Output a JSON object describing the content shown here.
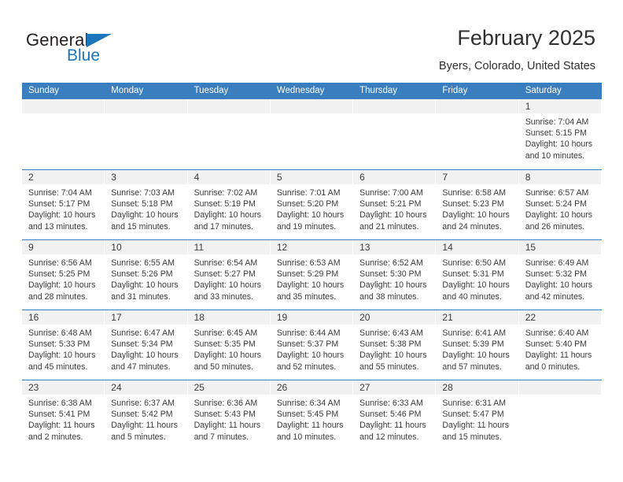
{
  "brand": {
    "name_part1": "General",
    "name_part2": "Blue",
    "triangle_icon": "triangle-icon",
    "accent_color": "#1c76bc"
  },
  "header": {
    "title": "February 2025",
    "location": "Byers, Colorado, United States"
  },
  "theme": {
    "header_blue": "#3a7ebf",
    "daynum_band": "#f1f1f1",
    "text": "#3b3b3b"
  },
  "calendar": {
    "weekdays": [
      "Sunday",
      "Monday",
      "Tuesday",
      "Wednesday",
      "Thursday",
      "Friday",
      "Saturday"
    ],
    "weeks": [
      [
        {
          "day": "",
          "lines": []
        },
        {
          "day": "",
          "lines": []
        },
        {
          "day": "",
          "lines": []
        },
        {
          "day": "",
          "lines": []
        },
        {
          "day": "",
          "lines": []
        },
        {
          "day": "",
          "lines": []
        },
        {
          "day": "1",
          "lines": [
            "Sunrise: 7:04 AM",
            "Sunset: 5:15 PM",
            "Daylight: 10 hours",
            "and 10 minutes."
          ]
        }
      ],
      [
        {
          "day": "2",
          "lines": [
            "Sunrise: 7:04 AM",
            "Sunset: 5:17 PM",
            "Daylight: 10 hours",
            "and 13 minutes."
          ]
        },
        {
          "day": "3",
          "lines": [
            "Sunrise: 7:03 AM",
            "Sunset: 5:18 PM",
            "Daylight: 10 hours",
            "and 15 minutes."
          ]
        },
        {
          "day": "4",
          "lines": [
            "Sunrise: 7:02 AM",
            "Sunset: 5:19 PM",
            "Daylight: 10 hours",
            "and 17 minutes."
          ]
        },
        {
          "day": "5",
          "lines": [
            "Sunrise: 7:01 AM",
            "Sunset: 5:20 PM",
            "Daylight: 10 hours",
            "and 19 minutes."
          ]
        },
        {
          "day": "6",
          "lines": [
            "Sunrise: 7:00 AM",
            "Sunset: 5:21 PM",
            "Daylight: 10 hours",
            "and 21 minutes."
          ]
        },
        {
          "day": "7",
          "lines": [
            "Sunrise: 6:58 AM",
            "Sunset: 5:23 PM",
            "Daylight: 10 hours",
            "and 24 minutes."
          ]
        },
        {
          "day": "8",
          "lines": [
            "Sunrise: 6:57 AM",
            "Sunset: 5:24 PM",
            "Daylight: 10 hours",
            "and 26 minutes."
          ]
        }
      ],
      [
        {
          "day": "9",
          "lines": [
            "Sunrise: 6:56 AM",
            "Sunset: 5:25 PM",
            "Daylight: 10 hours",
            "and 28 minutes."
          ]
        },
        {
          "day": "10",
          "lines": [
            "Sunrise: 6:55 AM",
            "Sunset: 5:26 PM",
            "Daylight: 10 hours",
            "and 31 minutes."
          ]
        },
        {
          "day": "11",
          "lines": [
            "Sunrise: 6:54 AM",
            "Sunset: 5:27 PM",
            "Daylight: 10 hours",
            "and 33 minutes."
          ]
        },
        {
          "day": "12",
          "lines": [
            "Sunrise: 6:53 AM",
            "Sunset: 5:29 PM",
            "Daylight: 10 hours",
            "and 35 minutes."
          ]
        },
        {
          "day": "13",
          "lines": [
            "Sunrise: 6:52 AM",
            "Sunset: 5:30 PM",
            "Daylight: 10 hours",
            "and 38 minutes."
          ]
        },
        {
          "day": "14",
          "lines": [
            "Sunrise: 6:50 AM",
            "Sunset: 5:31 PM",
            "Daylight: 10 hours",
            "and 40 minutes."
          ]
        },
        {
          "day": "15",
          "lines": [
            "Sunrise: 6:49 AM",
            "Sunset: 5:32 PM",
            "Daylight: 10 hours",
            "and 42 minutes."
          ]
        }
      ],
      [
        {
          "day": "16",
          "lines": [
            "Sunrise: 6:48 AM",
            "Sunset: 5:33 PM",
            "Daylight: 10 hours",
            "and 45 minutes."
          ]
        },
        {
          "day": "17",
          "lines": [
            "Sunrise: 6:47 AM",
            "Sunset: 5:34 PM",
            "Daylight: 10 hours",
            "and 47 minutes."
          ]
        },
        {
          "day": "18",
          "lines": [
            "Sunrise: 6:45 AM",
            "Sunset: 5:35 PM",
            "Daylight: 10 hours",
            "and 50 minutes."
          ]
        },
        {
          "day": "19",
          "lines": [
            "Sunrise: 6:44 AM",
            "Sunset: 5:37 PM",
            "Daylight: 10 hours",
            "and 52 minutes."
          ]
        },
        {
          "day": "20",
          "lines": [
            "Sunrise: 6:43 AM",
            "Sunset: 5:38 PM",
            "Daylight: 10 hours",
            "and 55 minutes."
          ]
        },
        {
          "day": "21",
          "lines": [
            "Sunrise: 6:41 AM",
            "Sunset: 5:39 PM",
            "Daylight: 10 hours",
            "and 57 minutes."
          ]
        },
        {
          "day": "22",
          "lines": [
            "Sunrise: 6:40 AM",
            "Sunset: 5:40 PM",
            "Daylight: 11 hours",
            "and 0 minutes."
          ]
        }
      ],
      [
        {
          "day": "23",
          "lines": [
            "Sunrise: 6:38 AM",
            "Sunset: 5:41 PM",
            "Daylight: 11 hours",
            "and 2 minutes."
          ]
        },
        {
          "day": "24",
          "lines": [
            "Sunrise: 6:37 AM",
            "Sunset: 5:42 PM",
            "Daylight: 11 hours",
            "and 5 minutes."
          ]
        },
        {
          "day": "25",
          "lines": [
            "Sunrise: 6:36 AM",
            "Sunset: 5:43 PM",
            "Daylight: 11 hours",
            "and 7 minutes."
          ]
        },
        {
          "day": "26",
          "lines": [
            "Sunrise: 6:34 AM",
            "Sunset: 5:45 PM",
            "Daylight: 11 hours",
            "and 10 minutes."
          ]
        },
        {
          "day": "27",
          "lines": [
            "Sunrise: 6:33 AM",
            "Sunset: 5:46 PM",
            "Daylight: 11 hours",
            "and 12 minutes."
          ]
        },
        {
          "day": "28",
          "lines": [
            "Sunrise: 6:31 AM",
            "Sunset: 5:47 PM",
            "Daylight: 11 hours",
            "and 15 minutes."
          ]
        },
        {
          "day": "",
          "lines": []
        }
      ]
    ]
  }
}
